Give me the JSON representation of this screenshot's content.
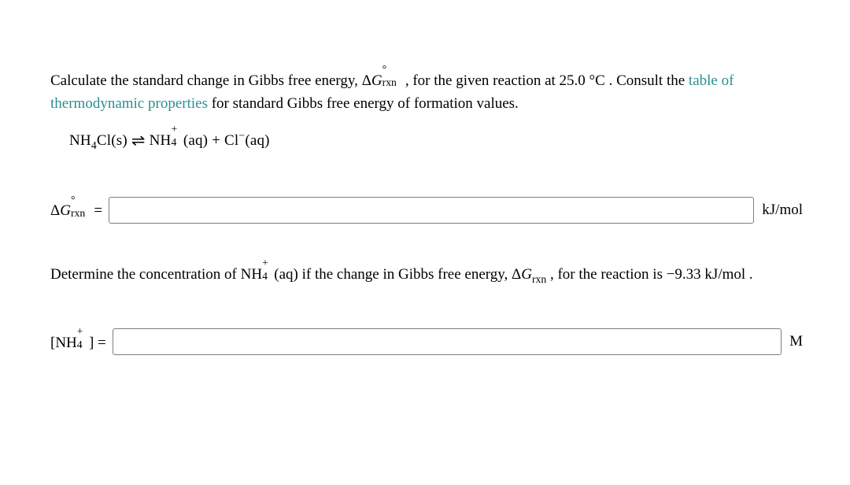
{
  "q1": {
    "intro_a": "Calculate the standard change in Gibbs free energy, ",
    "symbol_text": "ΔG°_rxn",
    "intro_b": " , for the given reaction at 25.0 °C . Consult the ",
    "link1": "table of thermodynamic properties",
    "intro_c": " for standard Gibbs free energy of formation values.",
    "equation": "NH₄Cl(s) ⇌ NH₄⁺(aq) + Cl⁻(aq)",
    "answer_label": "ΔG°_rxn =",
    "answer_unit": "kJ/mol"
  },
  "q2": {
    "text_a": "Determine the concentration of ",
    "species": "NH₄⁺(aq)",
    "text_b": " if the change in Gibbs free energy, ",
    "symbol": "ΔG_rxn",
    "text_c": " , for the reaction is ",
    "value": "−9.33 kJ/mol",
    "text_d": " .",
    "answer_label": "[NH₄⁺] =",
    "answer_unit": "M"
  }
}
